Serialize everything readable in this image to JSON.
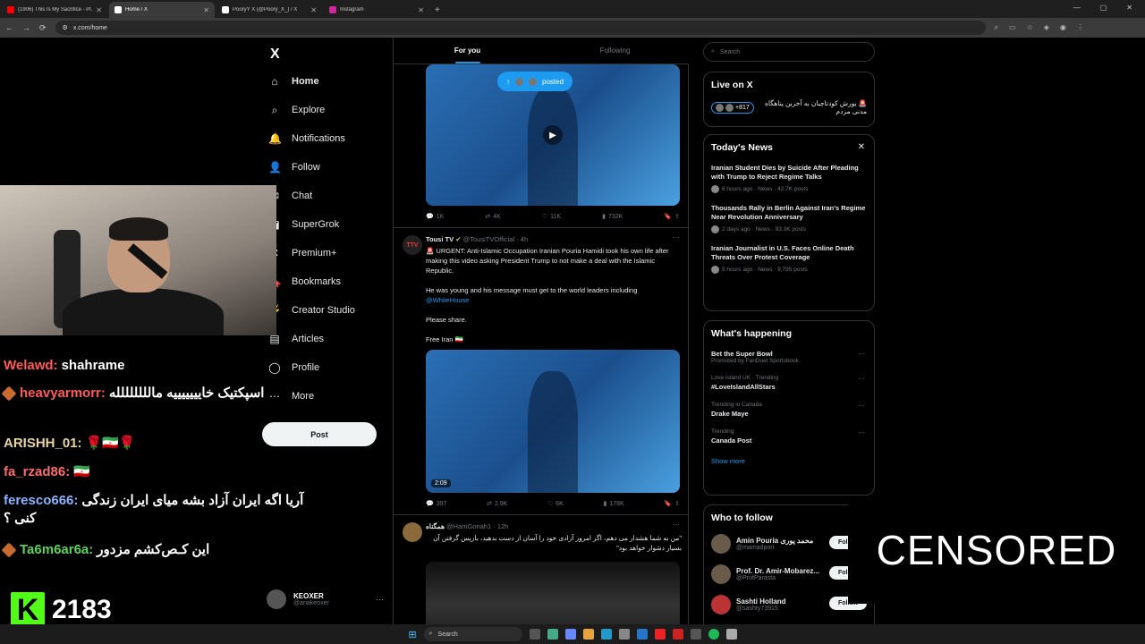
{
  "browser": {
    "tabs": [
      {
        "title": "(1906) This Is My Sacrifice - Pl...",
        "fav_color": "#ff0000"
      },
      {
        "title": "Home / X",
        "fav_color": "#ffffff"
      },
      {
        "title": "PooryY X (@Poory_X_) / X",
        "fav_color": "#ffffff"
      },
      {
        "title": "Instagram",
        "fav_color": "#d6249f"
      }
    ],
    "url": "x.com/home"
  },
  "nav": {
    "logo": "X",
    "items": [
      {
        "label": "Home",
        "icon": "⌂"
      },
      {
        "label": "Explore",
        "icon": "⌕"
      },
      {
        "label": "Notifications",
        "icon": "🔔"
      },
      {
        "label": "Follow",
        "icon": "👤"
      },
      {
        "label": "Chat",
        "icon": "✉"
      },
      {
        "label": "SuperGrok",
        "icon": "◪"
      },
      {
        "label": "Premium+",
        "icon": "✕"
      },
      {
        "label": "Bookmarks",
        "icon": "🔖"
      },
      {
        "label": "Creator Studio",
        "icon": "⚡"
      },
      {
        "label": "Articles",
        "icon": "▤"
      },
      {
        "label": "Profile",
        "icon": "◯"
      },
      {
        "label": "More",
        "icon": "⋯"
      }
    ],
    "post_label": "Post",
    "account": {
      "name": "KEOXER",
      "handle": "@ariakeoxer"
    }
  },
  "feed": {
    "tabs": [
      "For you",
      "Following"
    ],
    "pill_label": "posted",
    "tweet1_actions": {
      "reply": "1K",
      "retweet": "4K",
      "like": "11K",
      "views": "732K"
    },
    "tweet2": {
      "avatar": "TTV",
      "name": "Tousi TV",
      "handle": "@TousiTVOfficial",
      "time": "· 4h",
      "p1": "🚨 URGENT: Anti-Islamic Occupation Iranian Pouria Hamidi took his own life after making this video asking President Trump to not make a deal with the Islamic Republic.",
      "p2": "He was young and his message must get to the world leaders including",
      "link": "@WhiteHouse",
      "p3": "Please share.",
      "p4": "Free Iran 🇮🇷",
      "duration": "2:09",
      "actions": {
        "reply": "397",
        "retweet": "2.9K",
        "like": "6K",
        "views": "178K"
      }
    },
    "tweet3": {
      "name": "همگناه",
      "handle": "@HamGonah1",
      "time": "· 12h",
      "text": "\"من به شما هشدار می دهم، اگر امروز آزادی خود را آسان از دست بدهید، بازپس گرفتن آن بسیار دشوار خواهد بود\""
    }
  },
  "sidebar": {
    "search_placeholder": "Search",
    "live": {
      "title": "Live on X",
      "text": "🚨 یورش کودتاچیان به آخرین پناهگاه مدنی مردم",
      "count": "+817"
    },
    "news": {
      "title": "Today's News",
      "items": [
        {
          "title": "Iranian Student Dies by Suicide After Pleading with Trump to Reject Regime Talks",
          "meta": "6 hours ago · News · 42.7K posts"
        },
        {
          "title": "Thousands Rally in Berlin Against Iran's Regime Near Revolution Anniversary",
          "meta": "2 days ago · News · 93.3K posts"
        },
        {
          "title": "Iranian Journalist in U.S. Faces Online Death Threats Over Protest Coverage",
          "meta": "5 hours ago · News · 9,795 posts"
        }
      ]
    },
    "happening": {
      "title": "What's happening",
      "items": [
        {
          "context": "",
          "name": "Bet the Super Bowl",
          "sub": "Promoted by FanDuel Sportsbook"
        },
        {
          "context": "Love Island UK · Trending",
          "name": "#LoveIslandAllStars",
          "sub": ""
        },
        {
          "context": "Trending in Canada",
          "name": "Drake Maye",
          "sub": ""
        },
        {
          "context": "Trending",
          "name": "Canada Post",
          "sub": ""
        }
      ],
      "show_more": "Show more"
    },
    "who_to_follow": {
      "title": "Who to follow",
      "items": [
        {
          "name": "Amin Pouria محمد پوری",
          "handle": "@mamadpori"
        },
        {
          "name": "Prof. Dr. Amir-Mobarez...",
          "handle": "@ProfParasta"
        },
        {
          "name": "Sashti Holland",
          "handle": "@sashty73915"
        }
      ],
      "follow_label": "Follow"
    }
  },
  "stream": {
    "chat": [
      {
        "user": "Welawd:",
        "msg": "shahrame",
        "color": "#ff5a5a",
        "badge": false
      },
      {
        "user": "heavyarmorr:",
        "msg": "اسپکتیک خایییییییه مالللللللله",
        "color": "#ff5a5a",
        "badge": true
      },
      {
        "user": "ARISHH_01:",
        "msg": "🌹🇮🇷🌹",
        "color": "#e8d5a0",
        "badge": false
      },
      {
        "user": "fa_rzad86:",
        "msg": "🇮🇷",
        "color": "#ff6b6b",
        "badge": false
      },
      {
        "user": "feresco666:",
        "msg": "آریا اگه ایران آزاد بشه میای ایران زندگی کنی ؟",
        "color": "#8ab4ff",
        "badge": false
      },
      {
        "user": "Ta6m6ar6a:",
        "msg": "این کـص‌کشم مزدور",
        "color": "#5bd35b",
        "badge": true
      }
    ],
    "viewer_count": "2183",
    "censored": "CENSORED"
  },
  "taskbar": {
    "search_label": "Search"
  }
}
